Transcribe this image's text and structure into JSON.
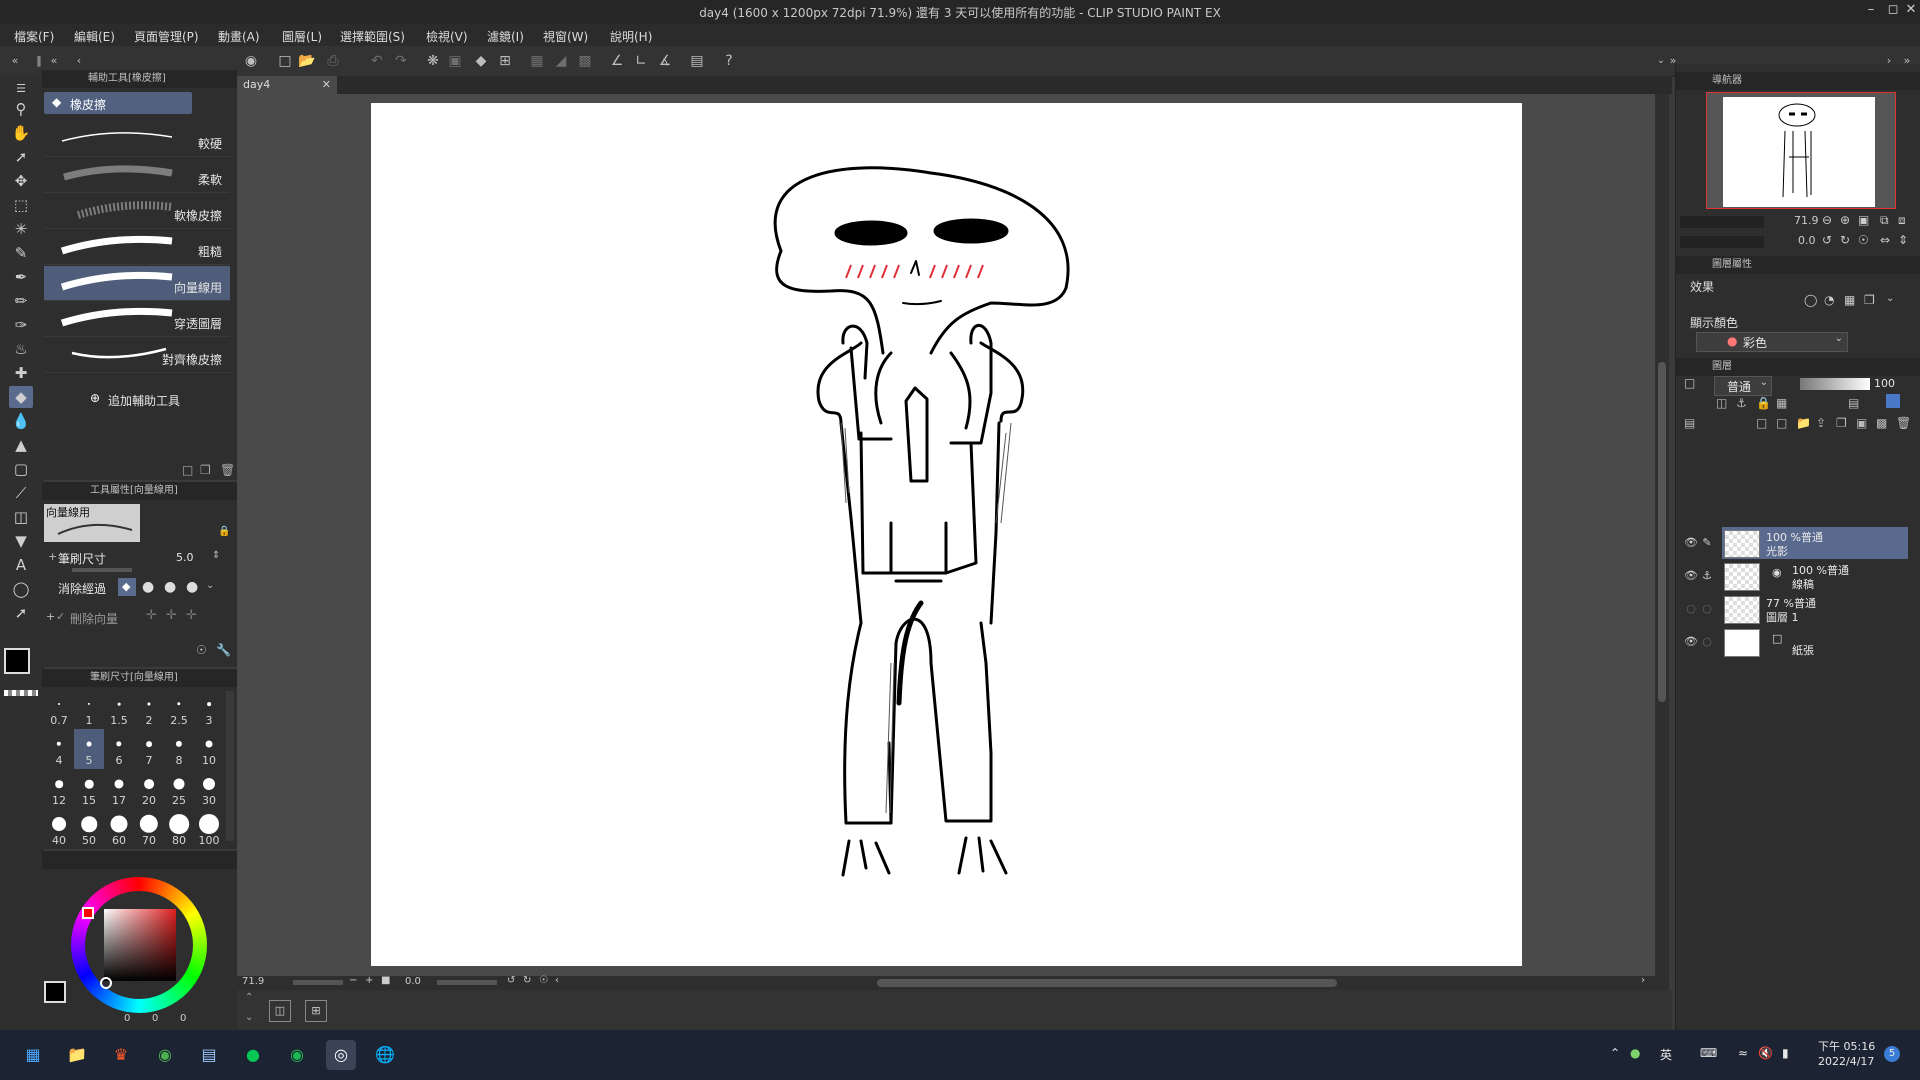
{
  "window": {
    "title": "day4 (1600 x 1200px 72dpi 71.9%)  還有 3 天可以使用所有的功能 - CLIP STUDIO PAINT EX"
  },
  "menu": [
    "檔案(F)",
    "編輯(E)",
    "頁面管理(P)",
    "動畫(A)",
    "圖層(L)",
    "選擇範圍(S)",
    "檢視(V)",
    "濾鏡(I)",
    "視窗(W)",
    "說明(H)"
  ],
  "subtool_panel": {
    "header": "輔助工具[橡皮擦]",
    "group": "橡皮擦",
    "brushes": [
      "較硬",
      "柔軟",
      "軟橡皮擦",
      "粗糙",
      "向量線用",
      "穿透圖層",
      "對齊橡皮擦"
    ],
    "selected_brush": "向量線用",
    "add_button": "追加輔助工具"
  },
  "tool_property": {
    "header": "工具屬性[向量線用]",
    "preset_label": "向量線用",
    "brush_size_label": "筆刷尺寸",
    "brush_size_value": "5.0",
    "erase_mode_label": "消除經過",
    "delete_vector_label": "刪除向量"
  },
  "brush_size_panel": {
    "header": "筆刷尺寸[向量線用]",
    "sizes": [
      "0.7",
      "1",
      "1.5",
      "2",
      "2.5",
      "3",
      "4",
      "5",
      "6",
      "7",
      "8",
      "10",
      "12",
      "15",
      "17",
      "20",
      "25",
      "30",
      "40",
      "50",
      "60",
      "70",
      "80",
      "100"
    ],
    "selected": "5"
  },
  "color_panel": {
    "values": [
      "0",
      "0",
      "0"
    ]
  },
  "document": {
    "tab": "day4",
    "zoom": "71.9",
    "rotation": "0.0"
  },
  "navigator": {
    "header": "導航器",
    "zoom": "71.9",
    "rotation": "0.0"
  },
  "layer_property": {
    "header": "圖層屬性",
    "effect_label": "效果",
    "display_color_label": "顯示顏色",
    "display_color_value": "彩色"
  },
  "layers_panel": {
    "header": "圖層",
    "blend_mode": "普通",
    "opacity": "100",
    "layers": [
      {
        "line1": "100 %普通",
        "line2": "光影",
        "selected": true
      },
      {
        "line1": "100 %普通",
        "line2": "線稿",
        "selected": false
      },
      {
        "line1": "77 %普通",
        "line2": "圖層 1",
        "selected": false
      },
      {
        "line1": "",
        "line2": "紙張",
        "selected": false
      }
    ]
  },
  "taskbar": {
    "ime": "英",
    "time": "下午 05:16",
    "date": "2022/4/17",
    "notification_count": "5"
  },
  "colors": {
    "accent_selection": "#5a6a8e",
    "canvas_bg": "#4a4a4a",
    "blush": "#e0303a"
  }
}
